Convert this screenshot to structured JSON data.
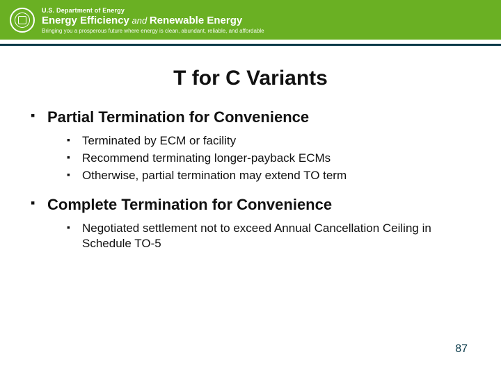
{
  "banner": {
    "department": "U.S. Department of Energy",
    "program_main_a": "Energy Efficiency",
    "program_and": " and ",
    "program_main_b": "Renewable Energy",
    "tagline": "Bringing you a prosperous future where energy is clean, abundant, reliable, and affordable"
  },
  "title": "T for C Variants",
  "page_number": "87",
  "sections": [
    {
      "heading": "Partial Termination for Convenience",
      "items": [
        "Terminated by ECM or facility",
        "Recommend terminating longer-payback ECMs",
        "Otherwise, partial termination may extend TO term"
      ]
    },
    {
      "heading": "Complete Termination for Convenience",
      "items": [
        "Negotiated settlement not to exceed Annual Cancellation Ceiling in Schedule TO-5"
      ]
    }
  ]
}
